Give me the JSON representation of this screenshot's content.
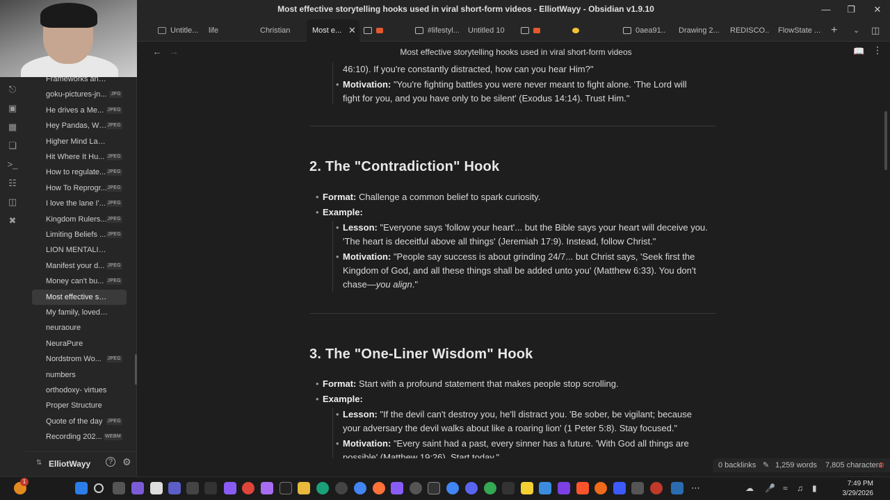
{
  "window": {
    "title": "Most effective storytelling hooks used in viral short-form videos - ElliotWayy - Obsidian v1.9.10"
  },
  "tabs": [
    {
      "label": "Untitle...",
      "icon": "document-icon"
    },
    {
      "label": "life",
      "icon": "none"
    },
    {
      "label": "Christian",
      "icon": "none"
    },
    {
      "label": "Most e...",
      "icon": "none",
      "active": true
    },
    {
      "label": "",
      "icon": "image-icon"
    },
    {
      "label": "#lifestyl...",
      "icon": "image-icon"
    },
    {
      "label": "Untitled 10",
      "icon": "none"
    },
    {
      "label": "",
      "icon": "image-icon"
    },
    {
      "label": "",
      "icon": "none"
    },
    {
      "label": "0aea91...",
      "icon": "image-icon"
    },
    {
      "label": "Drawing 2...",
      "icon": "none"
    },
    {
      "label": "REDISCO...",
      "icon": "none"
    },
    {
      "label": "FlowState ...",
      "icon": "none"
    }
  ],
  "note_title": "Most effective storytelling hooks used in viral short-form videos",
  "sidebar": {
    "files": [
      {
        "name": "Frameworks and App...",
        "badge": ""
      },
      {
        "name": "goku-pictures-jn...",
        "badge": "JPG"
      },
      {
        "name": "He drives a Me...",
        "badge": "JPEG"
      },
      {
        "name": "Hey Pandas, Wh...",
        "badge": "JPEG"
      },
      {
        "name": "Higher Mind Labs 10",
        "badge": ""
      },
      {
        "name": "Hit Where It Hu...",
        "badge": "JPEG"
      },
      {
        "name": "How to regulate...",
        "badge": "JPEG"
      },
      {
        "name": "How To Reprogr...",
        "badge": "JPEG"
      },
      {
        "name": "I love the lane I'...",
        "badge": "JPEG"
      },
      {
        "name": "Kingdom Rulers...",
        "badge": "JPEG"
      },
      {
        "name": "Limiting Beliefs ...",
        "badge": "JPEG"
      },
      {
        "name": "LION MENTALITY ME...",
        "badge": ""
      },
      {
        "name": "Manifest your d...",
        "badge": "JPEG"
      },
      {
        "name": "Money can't bu...",
        "badge": "JPEG"
      },
      {
        "name": "Most effective storyt...",
        "badge": "",
        "active": true
      },
      {
        "name": "My family, loved ones",
        "badge": ""
      },
      {
        "name": "neuraoure",
        "badge": ""
      },
      {
        "name": "NeuraPure",
        "badge": ""
      },
      {
        "name": "Nordstrom Wo...",
        "badge": "JPEG"
      },
      {
        "name": "numbers",
        "badge": ""
      },
      {
        "name": "orthodoxy- virtues",
        "badge": ""
      },
      {
        "name": "Proper Structure",
        "badge": ""
      },
      {
        "name": "Quote of the day",
        "badge": "JPEG"
      },
      {
        "name": "Recording 202...",
        "badge": "WEBM"
      }
    ],
    "vault_name": "ElliotWayy"
  },
  "content": {
    "top_cont": "46:10). If you're constantly distracted, how can you hear Him?\"",
    "top_motivation_label": "Motivation:",
    "top_motivation_text_1": " \"You're fighting battles you were never meant to fight alone. 'The Lord will",
    "top_motivation_text_2": "fight for you, and you have only to be silent' (Exodus 14:14). Trust Him.\"",
    "section2": {
      "heading": "2. The \"Contradiction\" Hook",
      "format_label": "Format:",
      "format_text": " Challenge a common belief to spark curiosity.",
      "example_label": "Example:",
      "lesson_label": "Lesson:",
      "lesson_text_1": " \"Everyone says 'follow your heart'... but the Bible says your heart will deceive you.",
      "lesson_text_2": "'The heart is deceitful above all things' (Jeremiah 17:9). Instead, follow Christ.\"",
      "motivation_label": "Motivation:",
      "motivation_text_1": " \"People say success is about grinding 24/7... but Christ says, 'Seek first the",
      "motivation_text_2": "Kingdom of God, and all these things shall be added unto you' (Matthew 6:33). You don't",
      "motivation_text_3a": "chase—",
      "motivation_text_3b": "you align",
      "motivation_text_3c": ".\""
    },
    "section3": {
      "heading": "3. The \"One-Liner Wisdom\" Hook",
      "format_label": "Format:",
      "format_text": " Start with a profound statement that makes people stop scrolling.",
      "example_label": "Example:",
      "lesson_label": "Lesson:",
      "lesson_text_1": " \"If the devil can't destroy you, he'll distract you. 'Be sober, be vigilant; because",
      "lesson_text_2": "your adversary the devil walks about like a roaring lion' (1 Peter 5:8). Stay focused.\"",
      "motivation_label": "Motivation:",
      "motivation_text_1": " \"Every saint had a past, every sinner has a future. 'With God all things are",
      "motivation_text_2": "possible' (Matthew 19:26). Start today.\""
    }
  },
  "status": {
    "backlinks": "0 backlinks",
    "words": "1,259 words",
    "characters": "7,805 characters"
  },
  "taskbar": {
    "time": "7:49 PM",
    "date": "3/29/2026",
    "notification_count": "1"
  },
  "colors": {
    "background": "#1e1e1e",
    "sidebar": "#262626",
    "accent": "#8a5cf6"
  }
}
